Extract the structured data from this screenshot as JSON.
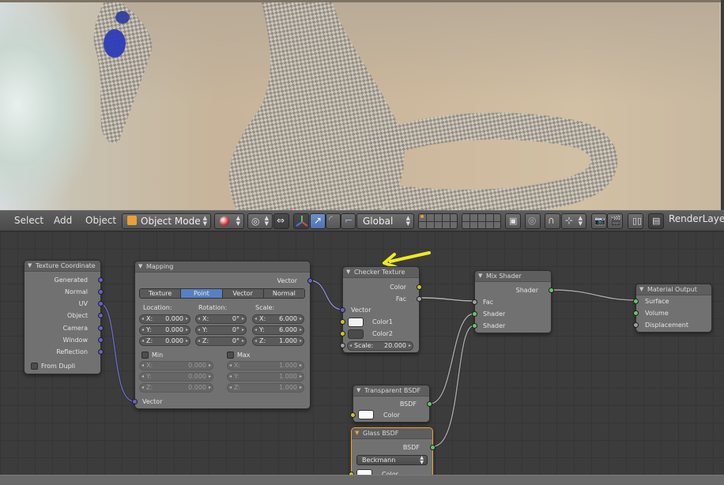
{
  "header3d": {
    "menu": {
      "select": "Select",
      "add": "Add",
      "object": "Object"
    },
    "mode_selector": "Object Mode",
    "transform_orientation": "Global",
    "render_layer": "RenderLayer"
  },
  "nodes": {
    "texture_coordinate": {
      "title": "Texture Coordinate",
      "outputs": [
        "Generated",
        "Normal",
        "UV",
        "Object",
        "Camera",
        "Window",
        "Reflection"
      ],
      "from_dupli": "From Dupli"
    },
    "mapping": {
      "title": "Mapping",
      "output": "Vector",
      "type_tabs": [
        "Texture",
        "Point",
        "Vector",
        "Normal"
      ],
      "active_tab": "Point",
      "location_label": "Location:",
      "rotation_label": "Rotation:",
      "scale_label": "Scale:",
      "location": {
        "x": "0.000",
        "y": "0.000",
        "z": "0.000"
      },
      "rotation": {
        "x": "0°",
        "y": "0°",
        "z": "0°"
      },
      "scale": {
        "x": "6.000",
        "y": "6.000",
        "z": "1.000"
      },
      "min_label": "Min",
      "max_label": "Max",
      "min": {
        "x": "0.000",
        "y": "0.000",
        "z": "0.000"
      },
      "max": {
        "x": "1.000",
        "y": "1.000",
        "z": "1.000"
      },
      "axis": {
        "x": "X:",
        "y": "Y:",
        "z": "Z:"
      },
      "input": "Vector"
    },
    "checker": {
      "title": "Checker Texture",
      "out_color": "Color",
      "out_fac": "Fac",
      "in_vector": "Vector",
      "color1": "Color1",
      "color2": "Color2",
      "scale_label": "Scale:",
      "scale_value": "20.000",
      "color1_swatch": "#f2f2f2",
      "color2_swatch": "#4a4a4a"
    },
    "mix_shader": {
      "title": "Mix Shader",
      "output": "Shader",
      "inputs": [
        "Fac",
        "Shader",
        "Shader"
      ]
    },
    "material_output": {
      "title": "Material Output",
      "inputs": [
        "Surface",
        "Volume",
        "Displacement"
      ]
    },
    "transparent": {
      "title": "Transparent BSDF",
      "output": "BSDF",
      "input": "Color"
    },
    "glass": {
      "title": "Glass BSDF",
      "output": "BSDF",
      "distribution": "Beckmann",
      "input": "Color"
    }
  },
  "colors": {
    "annotation_arrow": "#f2ea1c",
    "active_node_border": "#f0a23a",
    "socket_vector": "#6363c7",
    "socket_color": "#c7c729",
    "socket_shader": "#63c763",
    "socket_value": "#a1a1a1",
    "selected_tab": "#5680c2"
  }
}
